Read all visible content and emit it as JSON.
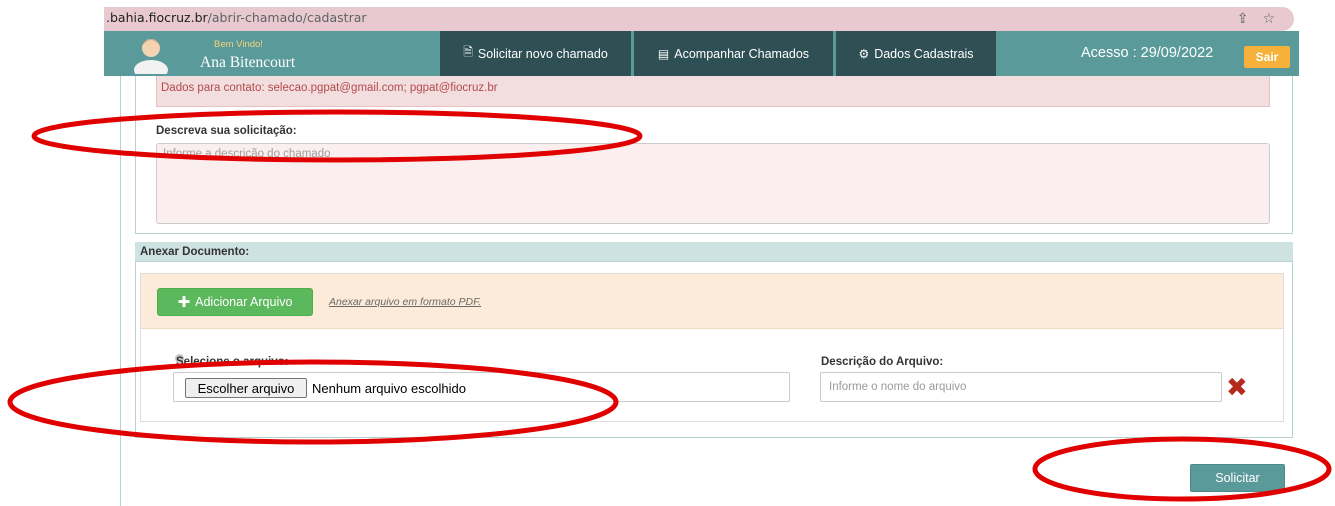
{
  "browser": {
    "url_host": ".bahia.fiocruz.br",
    "url_path": "/abrir-chamado/cadastrar"
  },
  "navbar": {
    "welcome": "Bem Vindo!",
    "username": "Ana Bitencourt",
    "tabs": [
      {
        "label": "Solicitar novo chamado",
        "icon": "document-icon"
      },
      {
        "label": "Acompanhar Chamados",
        "icon": "list-icon"
      },
      {
        "label": "Dados Cadastrais",
        "icon": "gear-icon"
      }
    ],
    "access": "Acesso : 29/09/2022",
    "logout_label": "Sair"
  },
  "form": {
    "contact_text": "Dados para contato: selecao.pgpat@gmail.com; pgpat@fiocruz.br",
    "description_label": "Descreva sua solicitação:",
    "description_placeholder": "Informe a descrição do chamado"
  },
  "attachments": {
    "title": "Anexar Documento:",
    "add_button": "Adicionar Arquivo",
    "pdf_note": "Anexar arquivo em formato PDF",
    "file_label": "Selecione o arquivo:",
    "file_button": "Escolher arquivo",
    "file_none": "Nenhum arquivo escolhido",
    "filename_label": "Descrição do Arquivo:",
    "filename_placeholder": "Informe o nome do arquivo"
  },
  "actions": {
    "submit_label": "Solicitar"
  },
  "colors": {
    "navbar": "#5b9a9a",
    "nav_tab": "#2e4f54",
    "logout": "#f5b13a",
    "add_button": "#5cb85c",
    "annotation": "#e00000"
  }
}
